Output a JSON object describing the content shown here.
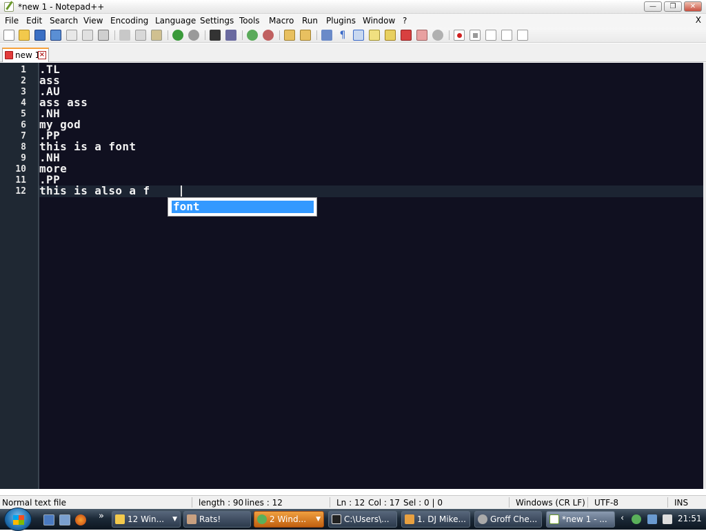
{
  "window": {
    "title": "*new 1 - Notepad++",
    "minimize_icon": "minimize-icon",
    "maximize_icon": "maximize-icon",
    "close_icon": "close-icon"
  },
  "menu": {
    "items": [
      "File",
      "Edit",
      "Search",
      "View",
      "Encoding",
      "Language",
      "Settings",
      "Tools",
      "Macro",
      "Run",
      "Plugins",
      "Window",
      "?"
    ],
    "close_doc": "X"
  },
  "toolbar": {
    "icons": [
      "new-file-icon",
      "open-file-icon",
      "save-icon",
      "save-all-icon",
      "close-icon",
      "close-all-icon",
      "print-icon",
      "cut-icon",
      "copy-icon",
      "paste-icon",
      "undo-icon",
      "redo-icon",
      "find-icon",
      "replace-icon",
      "zoom-in-icon",
      "zoom-out-icon",
      "sync-v-icon",
      "sync-h-icon",
      "word-wrap-icon",
      "show-all-chars-icon",
      "indent-guide-icon",
      "user-lang-icon",
      "function-list-icon",
      "folder-as-workspace-icon",
      "doc-map-icon",
      "monitor-icon",
      "record-macro-icon",
      "stop-record-icon",
      "play-macro-icon",
      "run-macro-multiple-icon",
      "save-macro-icon"
    ]
  },
  "tabs": [
    {
      "label": "new 1",
      "icon": "unsaved-file-icon",
      "close_icon": "tab-close-icon",
      "modified": true
    }
  ],
  "editor": {
    "lines": [
      {
        "n": "1",
        "text": ".TL"
      },
      {
        "n": "2",
        "text": "ass"
      },
      {
        "n": "3",
        "text": ".AU"
      },
      {
        "n": "4",
        "text": "ass ass"
      },
      {
        "n": "5",
        "text": ".NH"
      },
      {
        "n": "6",
        "text": "my god"
      },
      {
        "n": "7",
        "text": ".PP"
      },
      {
        "n": "8",
        "text": "this is a font"
      },
      {
        "n": "9",
        "text": ".NH"
      },
      {
        "n": "10",
        "text": "more"
      },
      {
        "n": "11",
        "text": ".PP"
      },
      {
        "n": "12",
        "text": "this is also a f"
      }
    ],
    "autocomplete": {
      "items": [
        "font"
      ],
      "selected": "font"
    }
  },
  "status": {
    "type": "Normal text file",
    "length": "length : 90",
    "lines": "lines : 12",
    "ln": "Ln : 12",
    "col": "Col : 17",
    "sel": "Sel : 0 | 0",
    "eol": "Windows (CR LF)",
    "encoding": "UTF-8",
    "mode": "INS"
  },
  "taskbar": {
    "buttons": [
      {
        "label": "12 Win...",
        "icon": "folder-icon",
        "dropdown": "▼"
      },
      {
        "label": "Rats!",
        "icon": "image-icon"
      },
      {
        "label": "2 Wind...",
        "icon": "messenger-icon",
        "dropdown": "▼",
        "state": "flash"
      },
      {
        "label": "C:\\Users\\...",
        "icon": "7zip-icon"
      },
      {
        "label": "1. DJ Mike...",
        "icon": "winamp-icon"
      },
      {
        "label": "Groff Che...",
        "icon": "cat-icon"
      },
      {
        "label": "*new 1 - ...",
        "icon": "notepadpp-icon",
        "state": "active"
      }
    ],
    "quicklaunch": [
      "show-desktop-icon",
      "switch-windows-icon",
      "firefox-icon"
    ],
    "more": "»",
    "tray_icons": [
      "tray-arrow-icon",
      "messenger-tray-icon",
      "network-icon",
      "volume-icon"
    ],
    "clock": "21:51"
  }
}
